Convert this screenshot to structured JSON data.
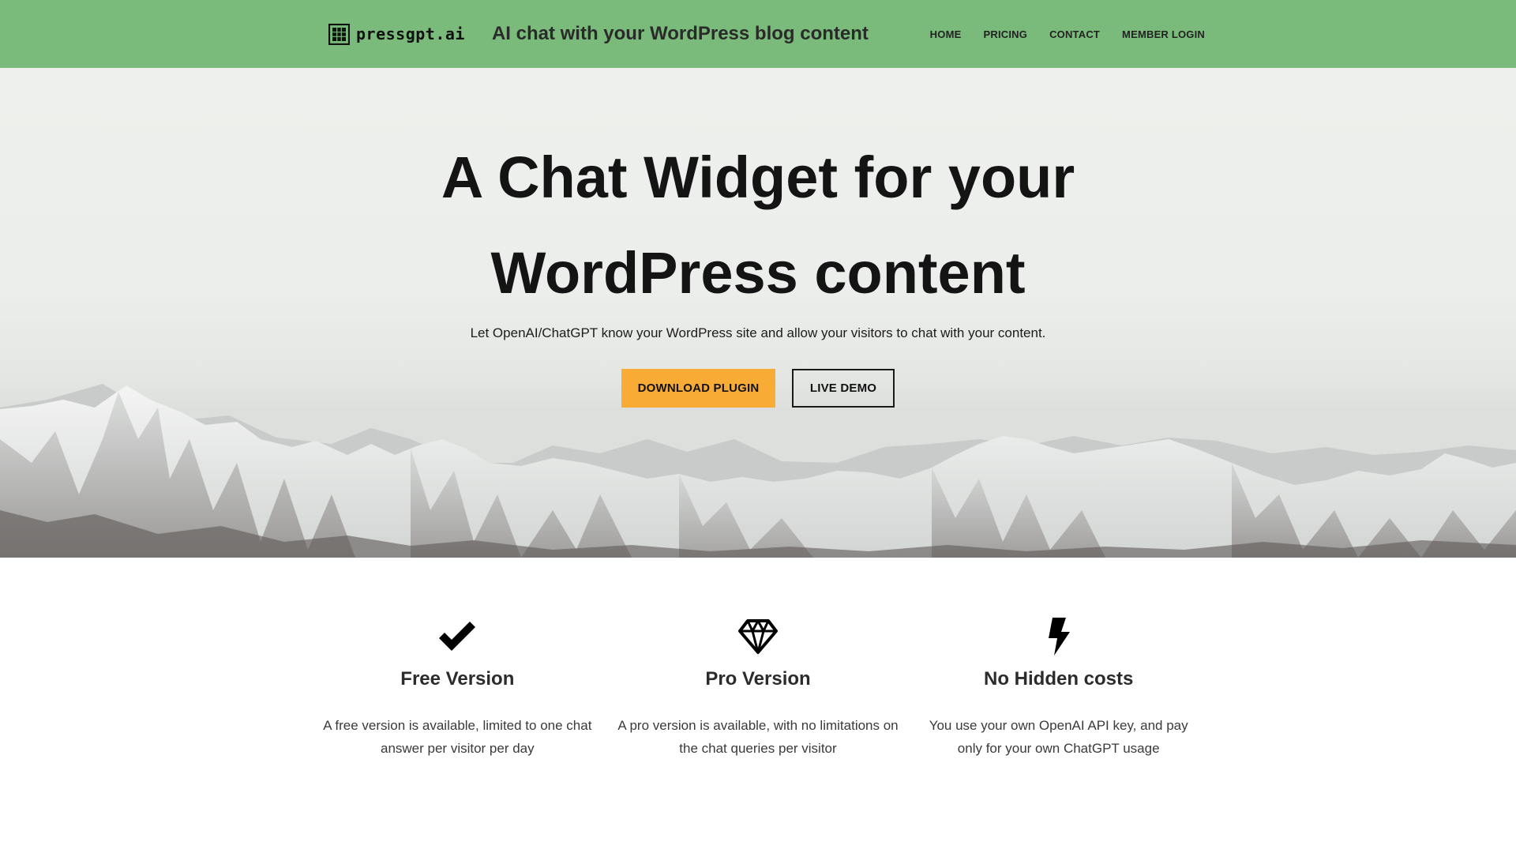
{
  "header": {
    "logo_text": "pressgpt.ai",
    "tagline": "AI chat with your WordPress blog content",
    "nav": [
      {
        "label": "HOME"
      },
      {
        "label": "PRICING"
      },
      {
        "label": "CONTACT"
      },
      {
        "label": "MEMBER LOGIN"
      }
    ],
    "background_color": "#7aba7a"
  },
  "hero": {
    "title_line1": "A Chat Widget for your",
    "title_line2": "WordPress content",
    "subtitle": "Let OpenAI/ChatGPT know your WordPress site and allow your visitors to chat with your content.",
    "primary_button": "DOWNLOAD PLUGIN",
    "secondary_button": "LIVE DEMO",
    "primary_button_color": "#f8ab35"
  },
  "features": [
    {
      "icon": "checkmark-icon",
      "title": "Free Version",
      "text": "A free version is available, limited to one chat answer per visitor per day"
    },
    {
      "icon": "diamond-icon",
      "title": "Pro Version",
      "text": "A pro version is available, with no limitations on the chat queries per visitor"
    },
    {
      "icon": "lightning-bolt-icon",
      "title": "No Hidden costs",
      "text": "You use your own OpenAI API key, and pay only for your own ChatGPT usage"
    }
  ]
}
